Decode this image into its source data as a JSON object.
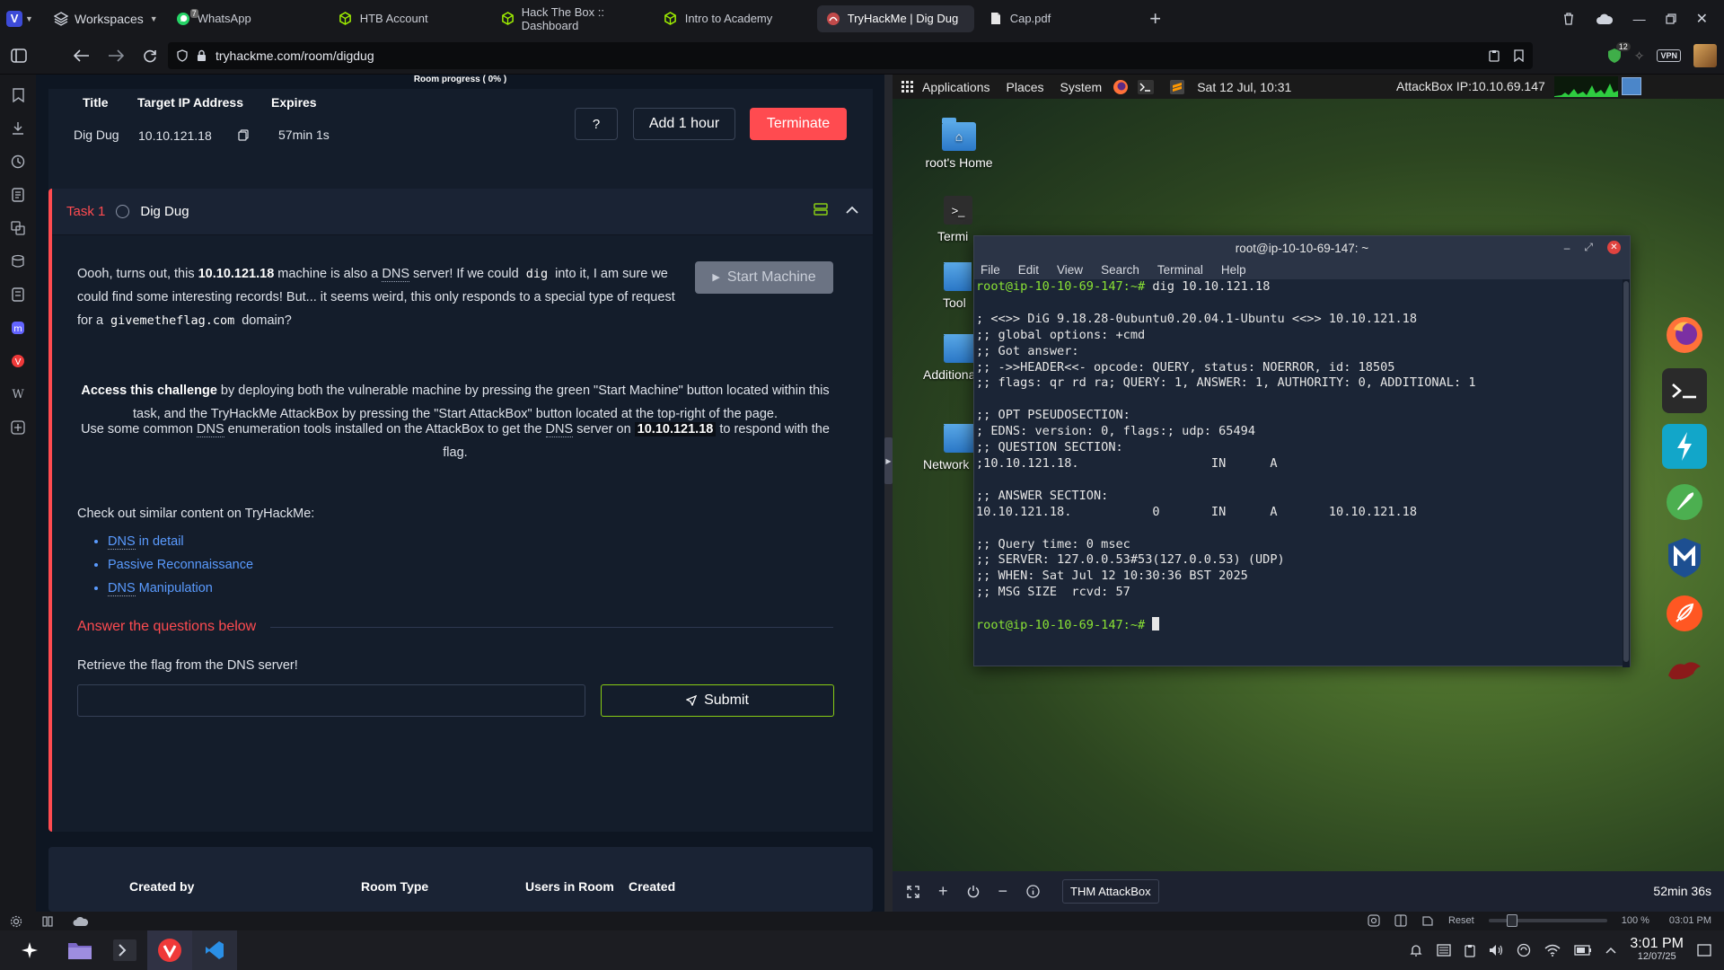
{
  "browser": {
    "workspaces_label": "Workspaces",
    "tabs": [
      {
        "label": "WhatsApp",
        "icon": "whatsapp-icon",
        "badge": "7"
      },
      {
        "label": "HTB Account",
        "icon": "htb-cube-icon"
      },
      {
        "label": "Hack The Box :: Dashboard",
        "icon": "htb-cube-icon"
      },
      {
        "label": "Intro to Academy",
        "icon": "htb-cube-icon"
      },
      {
        "label": "TryHackMe | Dig Dug",
        "icon": "thm-icon",
        "active": true
      },
      {
        "label": "Cap.pdf",
        "icon": "pdf-icon"
      }
    ],
    "url": "tryhackme.com/room/digdug",
    "extension_badge": "12",
    "vpn_label": "VPN"
  },
  "room": {
    "progress_label": "Room progress ( 0% )",
    "headers": {
      "title": "Title",
      "target_ip": "Target IP Address",
      "expires": "Expires"
    },
    "title": "Dig Dug",
    "target_ip": "10.10.121.18",
    "expires": "57min 1s",
    "help_label": "?",
    "add_hour_label": "Add 1 hour",
    "terminate_label": "Terminate"
  },
  "task": {
    "label": "Task 1",
    "title": "Dig Dug",
    "start_machine_label": "Start Machine",
    "intro": {
      "p1": "Oooh, turns out, this ",
      "ip": "10.10.121.18",
      "p2": " machine is also a ",
      "dns": "DNS",
      "p3": " server! If we could ",
      "dig": "dig",
      "p4": " into it, I am sure we could find some interesting records! But... it seems weird, this only responds to a special type of request for a ",
      "domain": "givemetheflag.com",
      "p5": " domain?"
    },
    "access": {
      "bold": "Access this challenge",
      "rest": " by deploying both the vulnerable machine by pressing the green \"Start Machine\" button located within this task, and the TryHackMe AttackBox by pressing the  \"Start AttackBox\" button located at the top-right of the page."
    },
    "use_common": {
      "p1": "Use some common ",
      "dns": "DNS",
      "p2": " enumeration tools installed on the AttackBox to get the ",
      "p3": " server on ",
      "ip": "10.10.121.18",
      "p4": " to respond with the flag."
    },
    "similar_heading": "Check out similar content on TryHackMe:",
    "similar_links": [
      {
        "abbr": "DNS",
        "rest": " in detail"
      },
      {
        "abbr": "",
        "rest": "Passive Reconnaissance"
      },
      {
        "abbr": "DNS",
        "rest": " Manipulation"
      }
    ],
    "answer_heading": "Answer the questions below",
    "question": "Retrieve the flag from the DNS server!",
    "answer_value": "",
    "submit_label": "Submit"
  },
  "room_info": {
    "created_by": "Created by",
    "room_type": "Room Type",
    "users_in_room": "Users in Room",
    "created": "Created"
  },
  "attackbox": {
    "panel": {
      "applications": "Applications",
      "places": "Places",
      "system": "System",
      "datetime": "Sat 12 Jul, 10:31",
      "ip_label": "AttackBox IP:10.10.69.147"
    },
    "desktop_icons": [
      "root's Home",
      "Termi",
      "Tool",
      "Additiona",
      "Network"
    ],
    "terminal": {
      "title": "root@ip-10-10-69-147: ~",
      "menu": [
        "File",
        "Edit",
        "View",
        "Search",
        "Terminal",
        "Help"
      ],
      "prompt": "root@ip-10-10-69-147:~#",
      "command": " dig 10.10.121.18",
      "output": [
        "",
        "; <<>> DiG 9.18.28-0ubuntu0.20.04.1-Ubuntu <<>> 10.10.121.18",
        ";; global options: +cmd",
        ";; Got answer:",
        ";; ->>HEADER<<- opcode: QUERY, status: NOERROR, id: 18505",
        ";; flags: qr rd ra; QUERY: 1, ANSWER: 1, AUTHORITY: 0, ADDITIONAL: 1",
        "",
        ";; OPT PSEUDOSECTION:",
        "; EDNS: version: 0, flags:; udp: 65494",
        ";; QUESTION SECTION:",
        ";10.10.121.18.                  IN      A",
        "",
        ";; ANSWER SECTION:",
        "10.10.121.18.           0       IN      A       10.10.121.18",
        "",
        ";; Query time: 0 msec",
        ";; SERVER: 127.0.0.53#53(127.0.0.53) (UDP)",
        ";; WHEN: Sat Jul 12 10:30:36 BST 2025",
        ";; MSG SIZE  rcvd: 57",
        ""
      ]
    },
    "toolbar_name": "THM AttackBox",
    "timer": "52min 36s"
  },
  "statusbar": {
    "reset_label": "Reset",
    "zoom": "100 %",
    "time": "03:01 PM"
  },
  "taskbar": {
    "time": "3:01 PM",
    "date": "12/07/25"
  }
}
